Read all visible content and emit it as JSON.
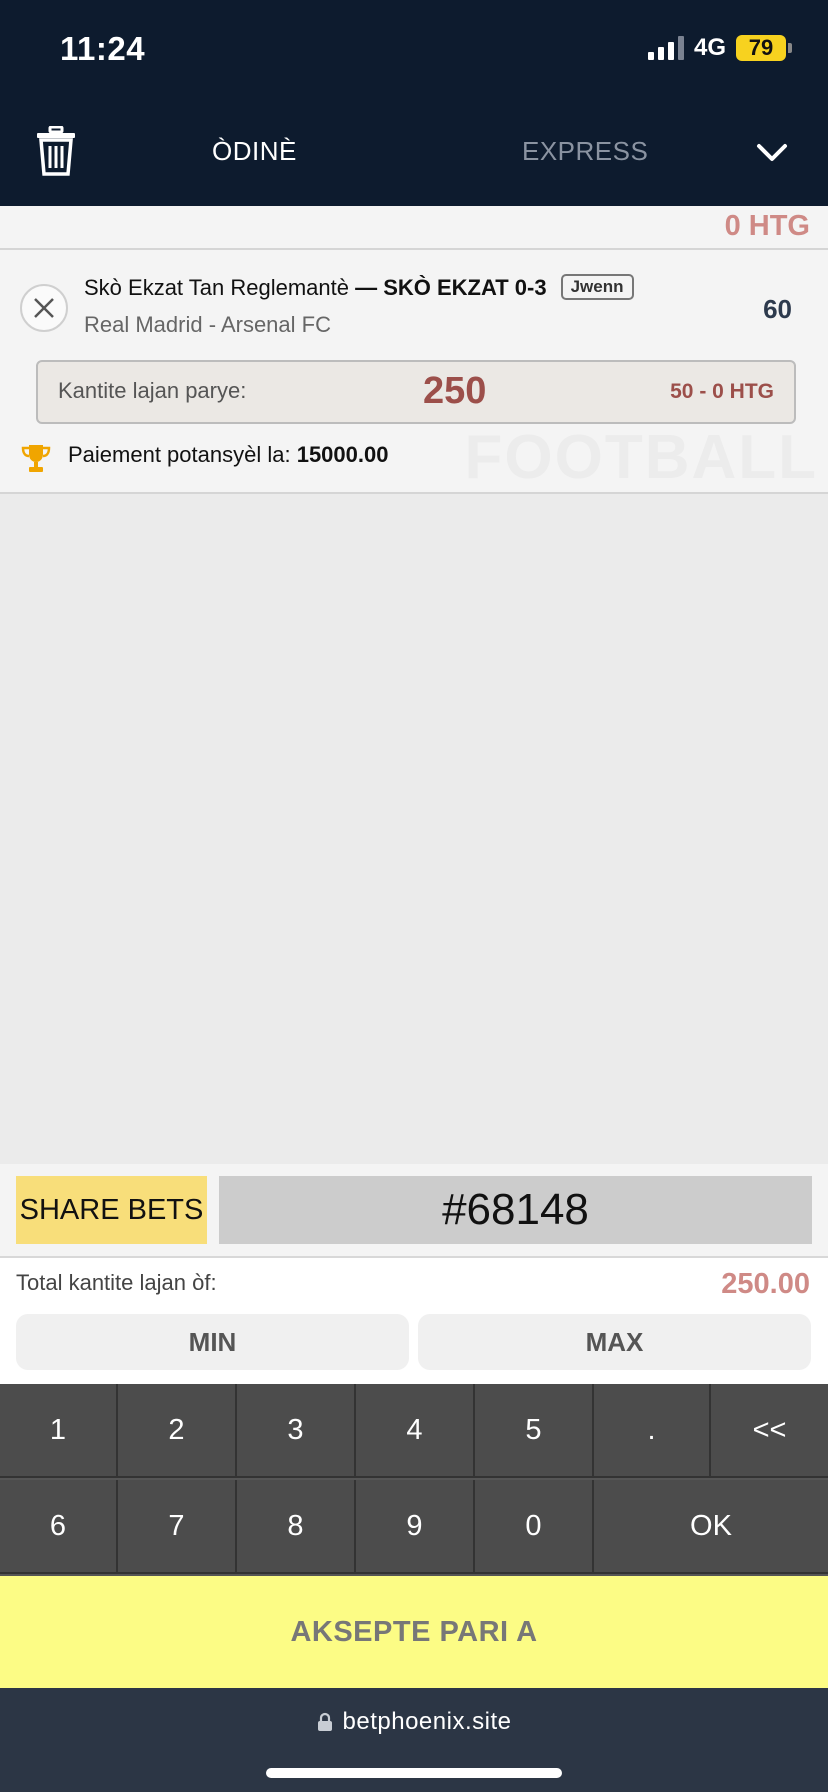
{
  "status_bar": {
    "time": "11:24",
    "network": "4G",
    "battery": "79"
  },
  "header": {
    "tab_single": "ÒDINÈ",
    "tab_express": "EXPRESS"
  },
  "balance": "0 HTG",
  "bet": {
    "market_prefix": "Skò Ekzat Tan Reglemantè",
    "market_sep": " — ",
    "market_outcome": "SKÒ EKZAT 0-3",
    "tag": "Jwenn",
    "event": "Real Madrid - Arsenal FC",
    "odds": "60",
    "stake_label": "Kantite lajan parye:",
    "stake_value": "250",
    "stake_limits": "50 - 0 HTG",
    "payout_label": "Paiement potansyèl la:",
    "payout_value": "15000.00",
    "sport_watermark": "FOOTBALL"
  },
  "share": {
    "button_label": "SHARE BETS",
    "code": "#68148"
  },
  "totals": {
    "label": "Total kantite lajan òf:",
    "value": "250.00",
    "min_label": "MIN",
    "max_label": "MAX"
  },
  "keypad": {
    "row1": [
      "1",
      "2",
      "3",
      "4",
      "5",
      ".",
      "<<"
    ],
    "row2": [
      "6",
      "7",
      "8",
      "9",
      "0"
    ],
    "ok_label": "OK"
  },
  "accept_label": "AKSEPTE PARI A",
  "browser": {
    "url": "betphoenix.site"
  },
  "colors": {
    "header_bg": "#0d1b2e",
    "accent_red": "#9c4f4a",
    "balance_pink": "#cf8a86",
    "share_yellow": "#f8de7a",
    "accept_yellow": "#fcfc85",
    "trophy_gold": "#f0a500"
  }
}
